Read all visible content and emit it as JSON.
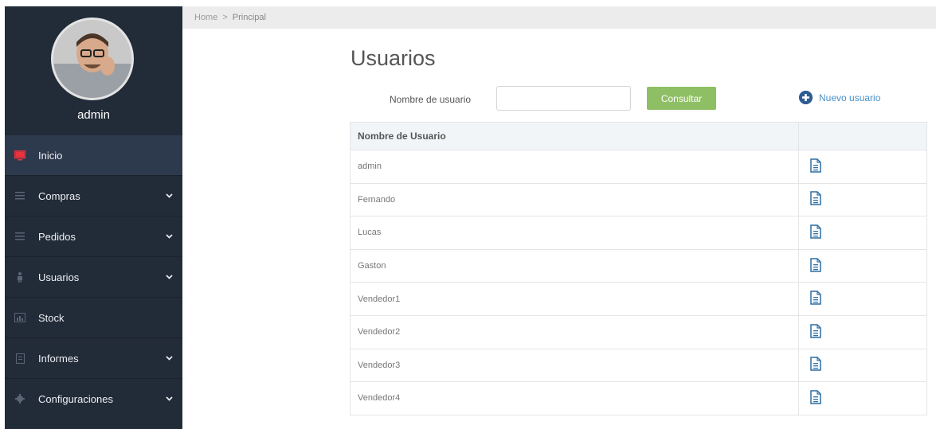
{
  "sidebar": {
    "username": "admin",
    "items": [
      {
        "label": "Inicio",
        "icon": "monitor-icon",
        "active": true,
        "has_chevron": false
      },
      {
        "label": "Compras",
        "icon": "list-icon",
        "active": false,
        "has_chevron": true
      },
      {
        "label": "Pedidos",
        "icon": "list-icon",
        "active": false,
        "has_chevron": true
      },
      {
        "label": "Usuarios",
        "icon": "user-icon",
        "active": false,
        "has_chevron": true
      },
      {
        "label": "Stock",
        "icon": "chart-icon",
        "active": false,
        "has_chevron": false
      },
      {
        "label": "Informes",
        "icon": "document-icon",
        "active": false,
        "has_chevron": true
      },
      {
        "label": "Configuraciones",
        "icon": "gear-icon",
        "active": false,
        "has_chevron": true
      }
    ]
  },
  "breadcrumb": {
    "home": "Home",
    "separator": ">",
    "current": "Principal"
  },
  "main": {
    "title": "Usuarios",
    "search_label": "Nombre de usuario",
    "search_value": "",
    "search_button": "Consultar",
    "new_user_label": "Nuevo usuario"
  },
  "table": {
    "headers": [
      "Nombre de Usuario",
      ""
    ],
    "rows": [
      {
        "name": "admin"
      },
      {
        "name": "Fernando"
      },
      {
        "name": "Lucas"
      },
      {
        "name": "Gaston"
      },
      {
        "name": "Vendedor1"
      },
      {
        "name": "Vendedor2"
      },
      {
        "name": "Vendedor3"
      },
      {
        "name": "Vendedor4"
      }
    ]
  },
  "colors": {
    "sidebar_bg": "#222b38",
    "sidebar_active": "#2d3a4e",
    "accent_red": "#e8323c",
    "button_green": "#8fbf65",
    "link_blue": "#4a90c8"
  }
}
